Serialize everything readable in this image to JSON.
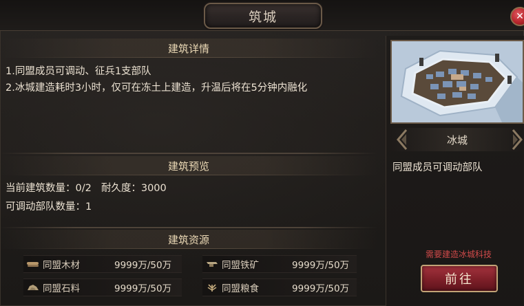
{
  "window": {
    "title": "筑城",
    "close_glyph": "✕"
  },
  "details": {
    "heading": "建筑详情",
    "line1": "1.同盟成员可调动、征兵1支部队",
    "line2": "2.冰城建造耗时3小时，仅可在冻土上建造，升温后将在5分钟内融化"
  },
  "preview": {
    "heading": "建筑预览",
    "count_label": "当前建筑数量：",
    "count_value": "0/2",
    "durability_label": "耐久度：",
    "durability_value": "3000",
    "troops_label": "可调动部队数量：",
    "troops_value": "1"
  },
  "resources": {
    "heading": "建筑资源",
    "items": [
      {
        "name": "同盟木材",
        "value": "9999万/50万",
        "icon": "wood-icon"
      },
      {
        "name": "同盟铁矿",
        "value": "9999万/50万",
        "icon": "iron-icon"
      },
      {
        "name": "同盟石料",
        "value": "9999万/50万",
        "icon": "stone-icon"
      },
      {
        "name": "同盟粮食",
        "value": "9999万/50万",
        "icon": "grain-icon"
      }
    ]
  },
  "building": {
    "name": "冰城",
    "description": "同盟成员可调动部队",
    "requirement": "需要建造冰城科技",
    "go_label": "前往"
  },
  "colors": {
    "accent_gold": "#c3a477",
    "button_red": "#7d1f28",
    "warning_red": "#d04a4a",
    "panel_dark": "#1b1917"
  }
}
